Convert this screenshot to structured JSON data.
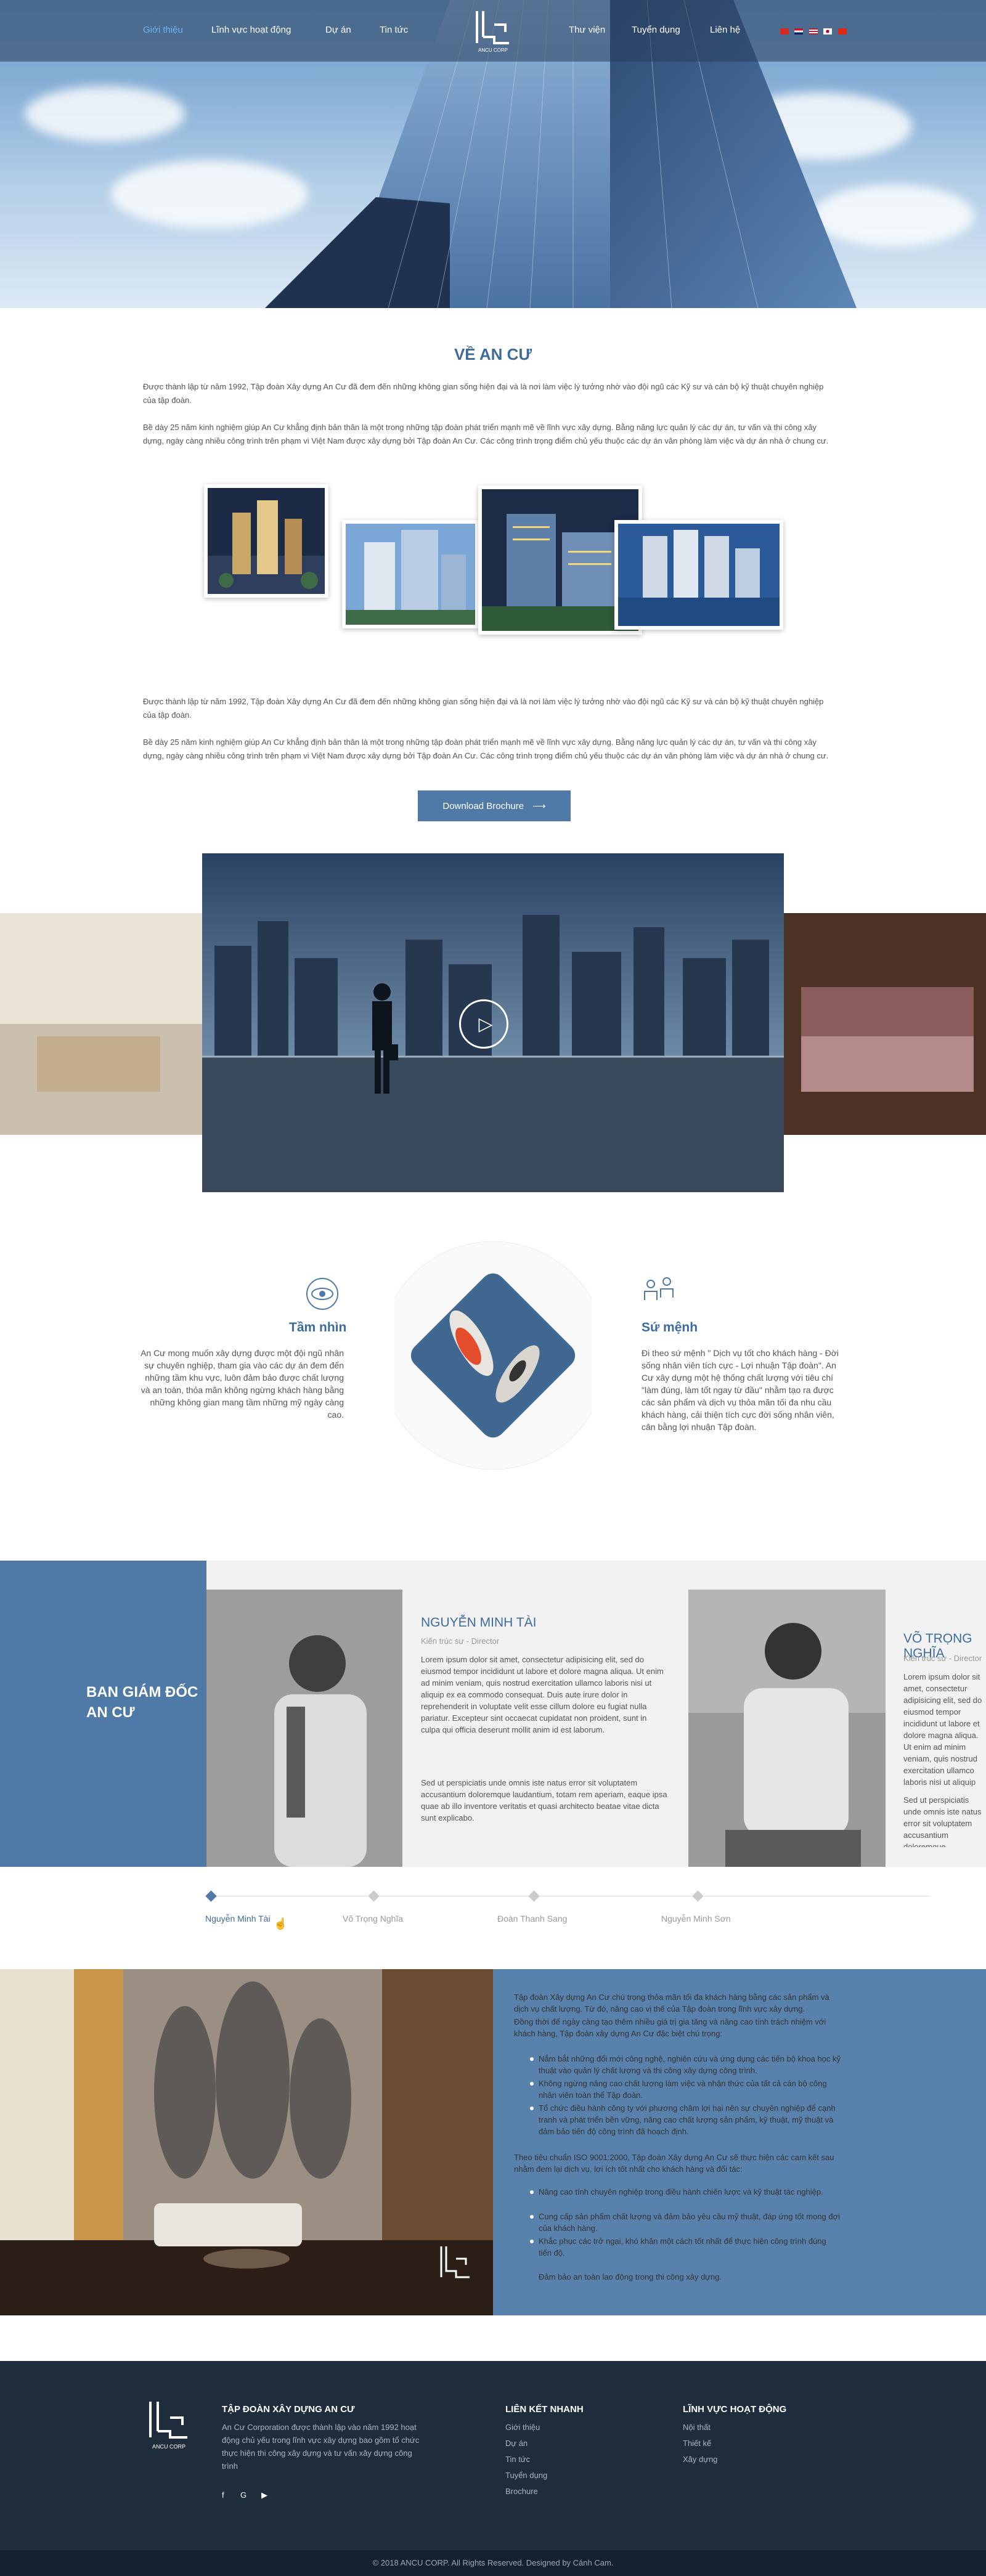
{
  "nav": {
    "left": [
      "Giới thiệu",
      "Lĩnh vực hoạt động",
      "Dự án",
      "Tin tức"
    ],
    "right": [
      "Thư viện",
      "Tuyển dụng",
      "Liên hệ"
    ],
    "logo_text": "ANCU CORP"
  },
  "about": {
    "title": "VỀ AN CƯ",
    "p1": "Được thành lập từ năm 1992, Tập đoàn Xây dựng An Cư đã đem đến những không gian sống hiện đại và là nơi làm việc lý tưởng nhờ vào đội ngũ các Kỹ sư và cán bộ kỹ thuật chuyên nghiệp của tập đoàn.",
    "p2": "Bề dày 25 năm kinh nghiệm giúp An Cư khẳng định bản thân là một trong những tập đoàn phát triển mạnh mẽ về lĩnh vực xây dựng. Bằng năng lực quản lý các dự án, tư vấn và thi công xây dựng, ngày càng nhiều công trình trên phạm vi Việt Nam được xây dựng bởi Tập đoàn An Cư. Các công trình trọng điểm chủ yếu thuộc các dự án văn phòng làm việc và dự án nhà ở chung cư.",
    "p3": "Được thành lập từ năm 1992, Tập đoàn Xây dựng An Cư đã đem đến những không gian sống hiện đại và là nơi làm việc lý tưởng nhờ vào đội ngũ các Kỹ sư và cán bộ kỹ thuật chuyên nghiệp của tập đoàn.",
    "p4": "Bề dày 25 năm kinh nghiệm giúp An Cư khẳng định bản thân là một trong những tập đoàn phát triển mạnh mẽ về lĩnh vực xây dựng. Bằng năng lực quản lý các dự án, tư vấn và thi công xây dựng, ngày càng nhiều công trình trên phạm vi Việt Nam được xây dựng bởi Tập đoàn An Cư. Các công trình trọng điểm chủ yếu thuộc các dự án văn phòng làm việc và dự án nhà ở chung cư.",
    "brochure": "Download Brochure"
  },
  "vision": {
    "title": "Tầm nhìn",
    "text": "An Cư mong muốn xây dựng được một đội ngũ nhân sự chuyên nghiệp, tham gia vào các dự án đem đến những tầm khu vực, luôn đảm bảo được chất lượng và an toàn, thỏa mãn không ngừng khách hàng bằng những không gian mang tầm những mỹ ngày càng cao."
  },
  "mission": {
    "title": "Sứ mệnh",
    "text": "Đi theo sứ mệnh \" Dịch vụ tốt cho khách hàng - Đời sống nhân viên tích cực - Lợi nhuận Tập đoàn\". An Cư xây dựng một hệ thống chất lượng với tiêu chí \"làm đúng, làm tốt ngay từ đầu\" nhằm tạo ra được các sản phẩm và dịch vụ thỏa mãn tối đa nhu cầu khách hàng, cải thiện tích cực đời sống nhân viên, cân bằng lợi nhuận Tập đoàn."
  },
  "board": {
    "heading": "BAN GIÁM ĐỐC AN CƯ",
    "person1": {
      "name": "NGUYỄN MINH TÀI",
      "role": "Kiến trúc sư - Director",
      "bio1": "Lorem ipsum dolor sit amet, consectetur adipisicing elit, sed do eiusmod tempor incididunt ut labore et dolore magna aliqua. Ut enim ad minim veniam, quis nostrud exercitation ullamco laboris nisi ut aliquip ex ea commodo consequat. Duis aute irure dolor in reprehenderit in voluptate velit esse cillum dolore eu fugiat nulla pariatur. Excepteur sint occaecat cupidatat non proident, sunt in culpa qui officia deserunt mollit anim id est laborum.",
      "bio2": "Sed ut perspiciatis unde omnis iste natus error sit voluptatem accusantium doloremque laudantium, totam rem aperiam, eaque ipsa quae ab illo inventore veritatis et quasi architecto beatae vitae dicta sunt explicabo."
    },
    "person2": {
      "name": "VÕ TRỌNG NGHĨA",
      "role": "Kiến trúc sư - Director",
      "bio1": "Lorem ipsum dolor sit amet, consectetur adipisicing elit, sed do eiusmod tempor incididunt ut labore et dolore magna aliqua. Ut enim ad minim veniam, quis nostrud exercitation ullamco laboris nisi ut aliquip ex ea commodo consequat. Duis aute irure dolor in reprehenderit in voluptate velit esse cillum dolore eu fugiat nulla pariatur. Excepteur sint occaecat cupidatat non proident, sunt in culpa qui officia deserunt mollit anim id est laborum.",
      "bio2": "Sed ut perspiciatis unde omnis iste natus error sit voluptatem accusantium doloremque laudantium, totam rem aperiam, eaque ipsa quae ab illo inventore veritatis et quasi architecto beatae vitae dicta sunt explicabo. Nemo enim ipsam voluptatem quia voluptas sit aspernatur."
    },
    "timeline": [
      "Nguyễn Minh Tài",
      "Võ Trọng Nghĩa",
      "Đoàn Thanh Sang",
      "Nguyễn Minh Sơn"
    ]
  },
  "values": {
    "intro": "Tập đoàn Xây dựng An Cư chú trọng thỏa mãn tối đa khách hàng bằng các sản phẩm và dịch vụ chất lượng. Từ đó, nâng cao vị thế của Tập đoàn trong lĩnh vực xây dựng.",
    "intro2": "Đồng thời để ngày càng tạo thêm nhiều giá trị gia tăng và nâng cao tính trách nhiệm với khách hàng, Tập đoàn xây dựng An Cư đặc biệt chú trọng:",
    "bullets1": [
      "Nắm bắt những đổi mới công nghệ, nghiên cứu và ứng dụng các tiến bộ khoa học kỹ thuật vào quản lý chất lượng và thi công xây dựng công trình.",
      "Không ngừng nâng cao chất lượng làm việc và nhận thức của tất cả cán bộ công nhân viên toàn thể Tập đoàn.",
      "Tổ chức điều hành công ty với phương châm lợi hại nên sự chuyên nghiệp để cạnh tranh và phát triển bền vững, nâng cao chất lượng sản phẩm, kỹ thuật, mỹ thuật và đảm bảo tiến độ công trình đã hoạch định."
    ],
    "middle": "Theo tiêu chuẩn ISO 9001:2000, Tập đoàn Xây dựng An Cư sẽ thực hiện các cam kết sau nhằm đem lại dịch vụ, lợi ích tốt nhất cho khách hàng và đối tác:",
    "bullets2": [
      "Nâng cao tính chuyên nghiệp trong điều hành chiến lược và kỹ thuật tác nghiệp.",
      "Cung cấp sản phẩm chất lượng và đảm bảo yêu cầu mỹ thuật, đáp ứng tốt mong đợi của khách hàng.",
      "Khắc phục các trở ngại, khó khăn một cách tốt nhất để thực hiện công trình đúng tiến độ.",
      "Đảm bảo an toàn lao động trong thi công xây dựng."
    ]
  },
  "footer": {
    "logo_text": "ANCU CORP",
    "company_title": "TẬP ĐOÀN XÂY DỰNG AN CƯ",
    "company_text": "An Cư Corporation được thành lập vào năm 1992 hoạt động chủ yếu trong lĩnh vực xây dựng bao gồm tổ chức thực hiện thi công xây dựng và tư vấn xây dựng công trình",
    "social": [
      "f",
      "G",
      "▶"
    ],
    "links_title": "LIÊN KẾT NHANH",
    "links": [
      "Giới thiệu",
      "Dự án",
      "Tin tức",
      "Tuyển dụng",
      "Brochure"
    ],
    "fields_title": "LĨNH VỰC HOẠT ĐỘNG",
    "fields": [
      "Nội thất",
      "Thiết kế",
      "Xây dựng"
    ],
    "copyright": "© 2018 ANCU CORP. All Rights Reserved. Designed by Cánh Cam."
  },
  "colors": {
    "primary": "#4f7aa7",
    "dark": "#1f2c3b",
    "title": "#3d6b9c"
  }
}
